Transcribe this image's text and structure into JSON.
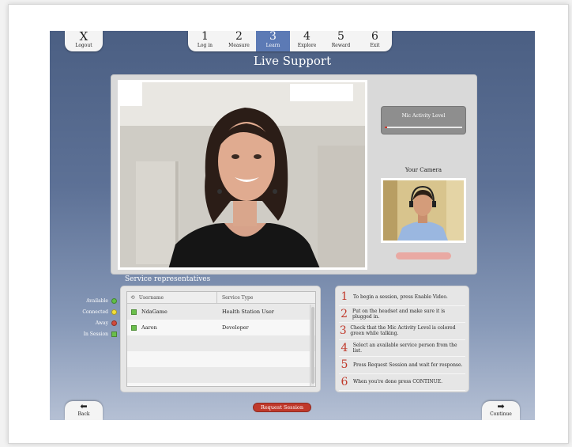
{
  "header": {
    "logout": {
      "glyph": "X",
      "label": "Logout"
    },
    "steps": [
      {
        "num": "1",
        "label": "Log in"
      },
      {
        "num": "2",
        "label": "Measure"
      },
      {
        "num": "3",
        "label": "Learn",
        "active": true
      },
      {
        "num": "4",
        "label": "Explore"
      },
      {
        "num": "5",
        "label": "Reward"
      },
      {
        "num": "6",
        "label": "Exit"
      }
    ],
    "title": "Live Support"
  },
  "video": {
    "mic_label": "Mic Activity Level",
    "mic_level": 0.03,
    "your_camera_label": "Your Camera"
  },
  "service": {
    "section_label": "Service representatives",
    "legend": [
      {
        "label": "Available",
        "color": "#5fbf45"
      },
      {
        "label": "Connected",
        "color": "#f3df3a"
      },
      {
        "label": "Away",
        "color": "#d14a3c"
      },
      {
        "label": "In Session",
        "color": "#6abf4b"
      }
    ],
    "columns": [
      "Username",
      "Service Type"
    ],
    "rows": [
      {
        "username": "NdaGame",
        "service_type": "Health Station User"
      },
      {
        "username": "Aaron",
        "service_type": "Developer"
      }
    ]
  },
  "instructions": [
    {
      "n": "1",
      "text": "To begin a session, press Enable Video."
    },
    {
      "n": "2",
      "text": "Put on the headset and make sure it is plugged in."
    },
    {
      "n": "3",
      "text": "Check that the Mic Activity Level is colored green while talking."
    },
    {
      "n": "4",
      "text": "Select an available service person from the list."
    },
    {
      "n": "5",
      "text": "Press Request Session and wait for response."
    },
    {
      "n": "6",
      "text": "When you're done press CONTINUE."
    }
  ],
  "actions": {
    "request_session": "Request Session",
    "back": "Back",
    "continue": "Continue"
  },
  "colors": {
    "accent": "#5c7ab5",
    "danger": "#c0392b",
    "background_top": "#4b5f83"
  }
}
